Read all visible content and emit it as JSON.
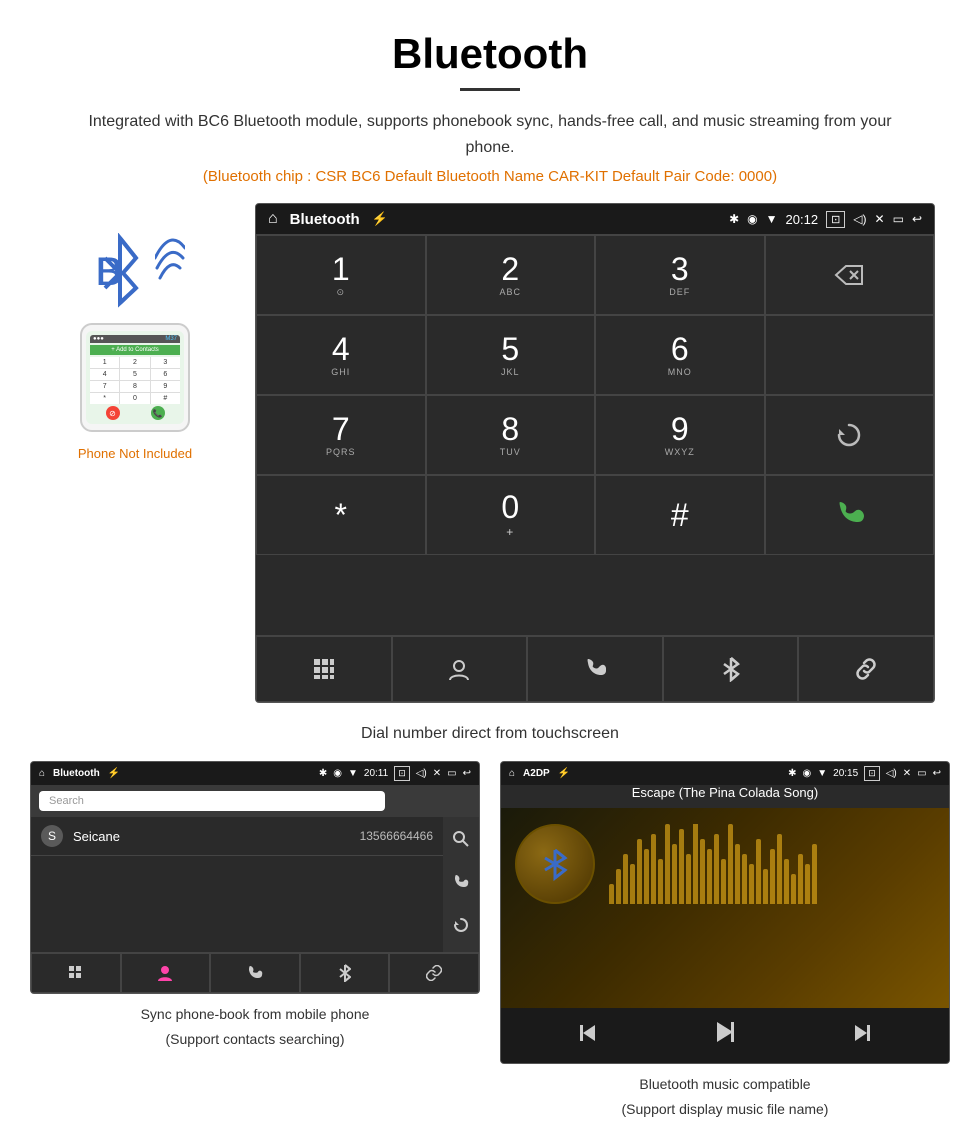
{
  "page": {
    "title": "Bluetooth",
    "description": "Integrated with BC6 Bluetooth module, supports phonebook sync, hands-free call, and music streaming from your phone.",
    "spec_line": "(Bluetooth chip : CSR BC6    Default Bluetooth Name CAR-KIT    Default Pair Code: 0000)",
    "dial_caption": "Dial number direct from touchscreen",
    "phone_not_included": "Phone Not Included"
  },
  "status_bar": {
    "app_name": "Bluetooth",
    "usb_icon": "⚡",
    "bt_icon": "✱",
    "location_icon": "◉",
    "signal_icon": "▼",
    "time": "20:12",
    "camera_icon": "⊡",
    "volume_icon": "◁)",
    "close_icon": "✕",
    "rect_icon": "▭",
    "back_icon": "↩",
    "home_icon": "⌂"
  },
  "dialpad": {
    "keys": [
      {
        "main": "1",
        "sub": ""
      },
      {
        "main": "2",
        "sub": "ABC"
      },
      {
        "main": "3",
        "sub": "DEF"
      },
      {
        "main": "",
        "sub": ""
      },
      {
        "main": "4",
        "sub": "GHI"
      },
      {
        "main": "5",
        "sub": "JKL"
      },
      {
        "main": "6",
        "sub": "MNO"
      },
      {
        "main": "",
        "sub": ""
      },
      {
        "main": "7",
        "sub": "PQRS"
      },
      {
        "main": "8",
        "sub": "TUV"
      },
      {
        "main": "9",
        "sub": "WXYZ"
      },
      {
        "main": "",
        "sub": ""
      },
      {
        "main": "*",
        "sub": ""
      },
      {
        "main": "0",
        "sub": "+"
      },
      {
        "main": "#",
        "sub": ""
      },
      {
        "main": "",
        "sub": ""
      }
    ],
    "row1_sub": [
      "⊙",
      "",
      ""
    ],
    "backspace": "⌫",
    "refresh": "⟳",
    "call_green": "📞",
    "call_end": "📞"
  },
  "bottom_bar": {
    "items": [
      "⊞",
      "👤",
      "📞",
      "✱",
      "🔗"
    ]
  },
  "phonebook": {
    "status_bar": {
      "app_name": "Bluetooth",
      "usb_icon": "⚡",
      "bt_icon": "✱",
      "time": "20:11"
    },
    "search_placeholder": "Search",
    "contact": {
      "letter": "S",
      "name": "Seicane",
      "number": "13566664466"
    },
    "right_icons": [
      "🔍",
      "📞",
      "⟳"
    ],
    "bottom_icons": [
      "⊞",
      "👤",
      "📞",
      "✱",
      "🔗"
    ]
  },
  "music": {
    "status_bar": {
      "app_name": "A2DP",
      "time": "20:15"
    },
    "song_title": "Escape (The Pina Colada Song)",
    "eq_bars": [
      20,
      35,
      50,
      40,
      65,
      55,
      70,
      45,
      80,
      60,
      75,
      50,
      85,
      65,
      55,
      70,
      45,
      80,
      60,
      50,
      40,
      65,
      35,
      55,
      70,
      45,
      30,
      50,
      40,
      60
    ],
    "controls": [
      "⏮",
      "⏯",
      "⏭"
    ]
  },
  "captions": {
    "phonebook": "Sync phone-book from mobile phone\n(Support contacts searching)",
    "phonebook_line1": "Sync phone-book from mobile phone",
    "phonebook_line2": "(Support contacts searching)",
    "music_line1": "Bluetooth music compatible",
    "music_line2": "(Support display music file name)"
  }
}
